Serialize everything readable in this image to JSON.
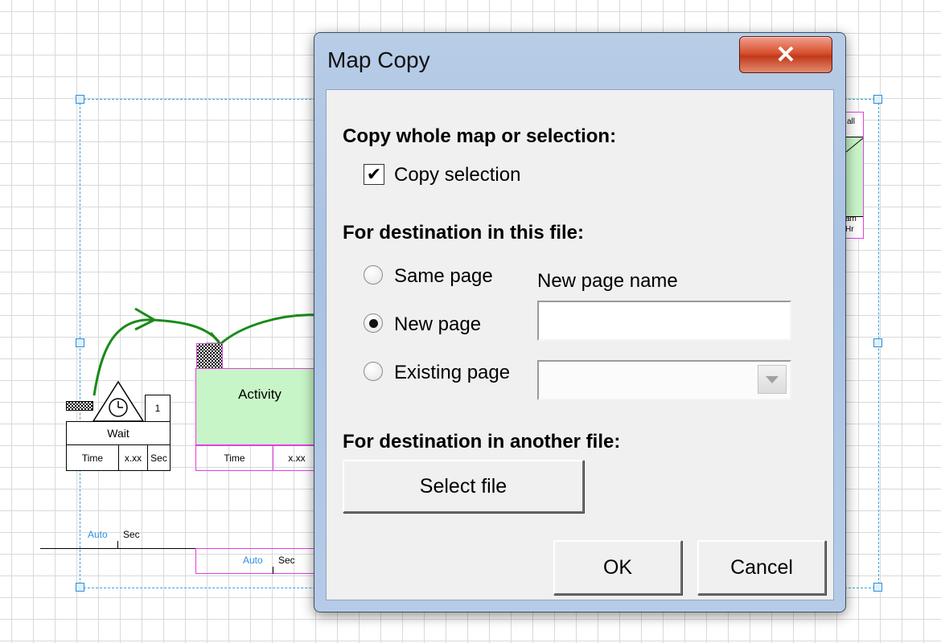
{
  "canvas": {
    "wait_shape": {
      "label": "Wait",
      "count": "1",
      "time_label": "Time",
      "time_value": "x.xx",
      "time_unit": "Sec"
    },
    "activity_shape": {
      "label": "Activity",
      "time_label": "Time",
      "time_value": "x.xx"
    },
    "timeline_left": {
      "mode": "Auto",
      "unit": "Sec"
    },
    "timeline_right": {
      "mode": "Auto",
      "unit": "Sec"
    },
    "partial_shape": {
      "top_text": "all",
      "bottom_text_1": "am",
      "bottom_text_2": "Hr"
    },
    "colors": {
      "grid": "#d9d9d9",
      "selection": "#3aa0e0",
      "arrow": "#1a8a1a",
      "activity_border": "#e040e0",
      "shape_fill": "#c8f5c8"
    }
  },
  "dialog": {
    "title": "Map Copy",
    "close_glyph": "✕",
    "section_copy": "Copy whole map or selection:",
    "copy_selection": {
      "label": "Copy selection",
      "checked": true,
      "glyph": "✔"
    },
    "section_this_file": "For destination in this file:",
    "radio_options": [
      {
        "label": "Same page",
        "selected": false
      },
      {
        "label": "New page",
        "selected": true
      },
      {
        "label": "Existing page",
        "selected": false
      }
    ],
    "new_page_name_label": "New page name",
    "new_page_name_value": "",
    "existing_page_value": "",
    "section_other_file": "For destination in another file:",
    "select_file_button": "Select file",
    "ok_button": "OK",
    "cancel_button": "Cancel"
  }
}
